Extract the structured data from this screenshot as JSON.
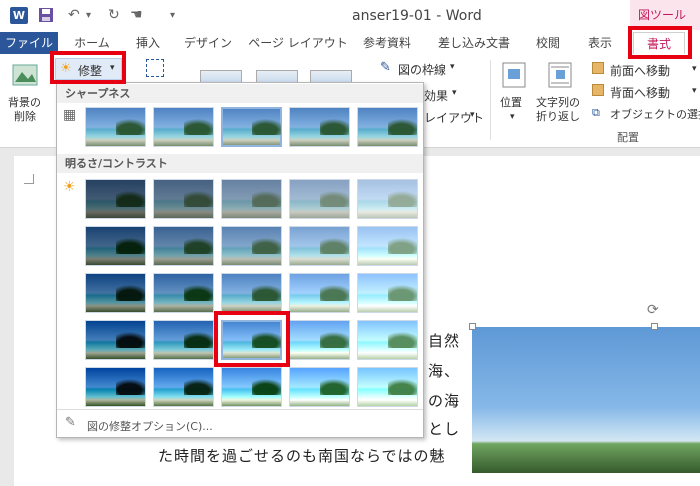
{
  "titlebar": {
    "app_icon": "W",
    "doc_title": "anser19-01 - Word",
    "contextual_tab_title": "図ツール",
    "qat_icons": [
      "save-icon",
      "undo-icon",
      "redo-icon",
      "touch-mode-icon",
      "customize-icon"
    ]
  },
  "tabs": [
    "ファイル",
    "ホーム",
    "挿入",
    "デザイン",
    "ページ レイアウト",
    "参考資料",
    "差し込み文書",
    "校閲",
    "表示",
    "書式"
  ],
  "ribbon": {
    "remove_bg_line1": "背景の",
    "remove_bg_line2": "削除",
    "corrections_label": "修整",
    "border_label": "図の枠線",
    "effects_label": "効果",
    "layout_label": "レイアウト",
    "position_label": "位置",
    "wrap_line1": "文字列の",
    "wrap_line2": "折り返し",
    "bring_forward": "前面へ移動",
    "send_backward": "背面へ移動",
    "selection_pane": "オブジェクトの選択と",
    "arrange_group": "配置"
  },
  "gallery": {
    "sharpness_header": "シャープネス",
    "brightness_header": "明るさ/コントラスト",
    "options_label": "図の修整オプション(C)...",
    "selected_sharpness_index": 2,
    "selected_brightness": {
      "row": 3,
      "col": 2
    }
  },
  "document": {
    "lines": [
      "自然",
      "海、",
      "の海",
      "とし",
      "た時間を過ごせるのも南国ならではの魅"
    ]
  },
  "colors": {
    "word_blue": "#2b579a",
    "contextual_pink": "#c2185b",
    "highlight_red": "#e60012"
  }
}
